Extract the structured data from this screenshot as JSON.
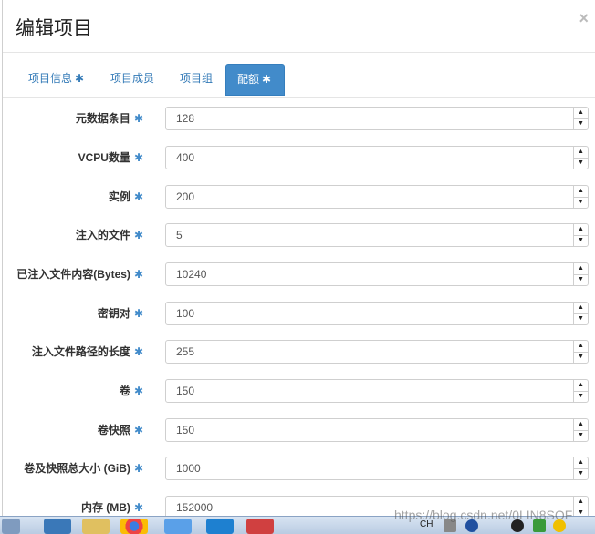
{
  "modal": {
    "title": "编辑项目",
    "close_glyph": "×"
  },
  "tabs": [
    {
      "label": "项目信息",
      "required": true
    },
    {
      "label": "项目成员",
      "required": false
    },
    {
      "label": "项目组",
      "required": false
    },
    {
      "label": "配额",
      "required": true,
      "active": true
    }
  ],
  "required_glyph": "✱",
  "quota_fields": [
    {
      "label": "元数据条目",
      "value": "128"
    },
    {
      "label": "VCPU数量",
      "value": "400"
    },
    {
      "label": "实例",
      "value": "200"
    },
    {
      "label": "注入的文件",
      "value": "5"
    },
    {
      "label": "已注入文件内容(Bytes)",
      "value": "10240"
    },
    {
      "label": "密钥对",
      "value": "100"
    },
    {
      "label": "注入文件路径的长度",
      "value": "255"
    },
    {
      "label": "卷",
      "value": "150"
    },
    {
      "label": "卷快照",
      "value": "150"
    },
    {
      "label": "卷及快照总大小 (GiB)",
      "value": "1000"
    },
    {
      "label": "内存 (MB)",
      "value": "152000"
    }
  ],
  "spinner": {
    "up": "▲",
    "down": "▼"
  },
  "watermark": "https://blog.csdn.net/0LIN8SOF",
  "taskbar": {
    "tray_text": "CH"
  },
  "colors": {
    "accent": "#428bca",
    "link": "#337ab7"
  }
}
